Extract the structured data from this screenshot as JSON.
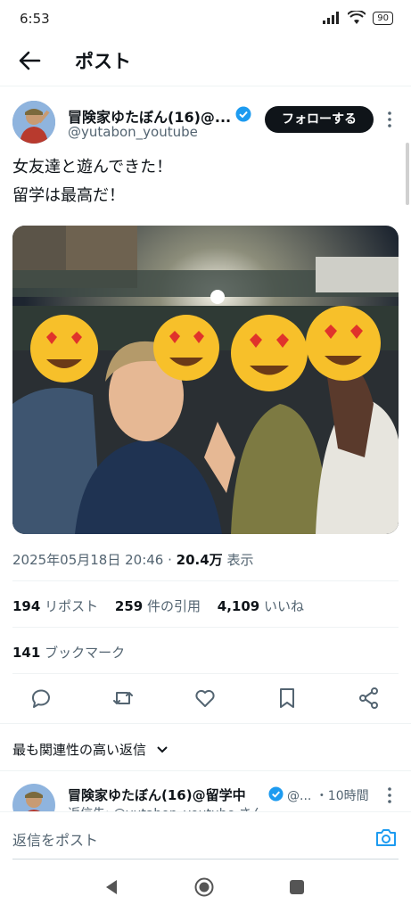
{
  "status": {
    "time": "6:53",
    "battery": "90"
  },
  "header": {
    "title": "ポスト"
  },
  "post": {
    "author_name": "冒険家ゆたぼん(16)@...",
    "handle": "@yutabon_youtube",
    "follow_label": "フォローする",
    "text_line1": "女友達と遊んできた！",
    "text_line2": "留学は最高だ！",
    "timestamp": "2025年05月18日 20:46",
    "views_count": "20.4万",
    "views_label": "表示",
    "reposts_count": "194",
    "reposts_label": "リポスト",
    "quotes_count": "259",
    "quotes_label": "件の引用",
    "likes_count": "4,109",
    "likes_label": "いいね",
    "bookmarks_count": "141",
    "bookmarks_label": "ブックマーク"
  },
  "replies_sort": {
    "label": "最も関連性の高い返信"
  },
  "reply": {
    "author_name": "冒険家ゆたぼん(16)@留学中",
    "handle": "@...",
    "time": "・10時間",
    "sub_text": "返信先: @yutabon_youtube さん"
  },
  "compose": {
    "placeholder": "返信をポスト"
  },
  "icons": [
    "back-arrow-icon",
    "verified-badge-icon",
    "more-icon",
    "reply-icon",
    "repost-icon",
    "like-icon",
    "bookmark-icon",
    "share-icon",
    "chevron-down-icon",
    "camera-icon",
    "nav-back-icon",
    "nav-home-icon",
    "nav-recents-icon"
  ],
  "colors": {
    "verified": "#1d9bf0",
    "follow_button": "#0f1419",
    "text_secondary": "#536471",
    "camera": "#1d9bf0"
  }
}
